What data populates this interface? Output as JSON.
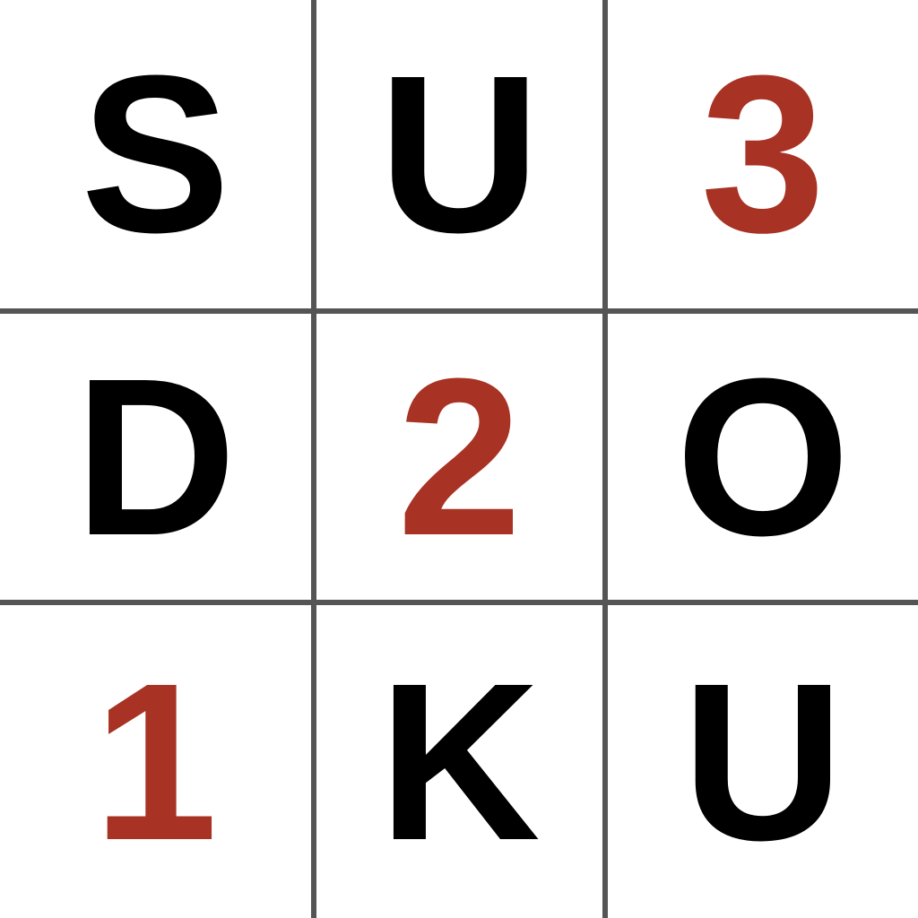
{
  "colors": {
    "letter": "#000000",
    "number": "#a83224",
    "grid": "#555555",
    "background": "#ffffff"
  },
  "grid": {
    "rows": [
      [
        {
          "value": "S",
          "kind": "letter"
        },
        {
          "value": "U",
          "kind": "letter"
        },
        {
          "value": "3",
          "kind": "number"
        }
      ],
      [
        {
          "value": "D",
          "kind": "letter"
        },
        {
          "value": "2",
          "kind": "number"
        },
        {
          "value": "O",
          "kind": "letter"
        }
      ],
      [
        {
          "value": "1",
          "kind": "number"
        },
        {
          "value": "K",
          "kind": "letter"
        },
        {
          "value": "U",
          "kind": "letter"
        }
      ]
    ]
  }
}
